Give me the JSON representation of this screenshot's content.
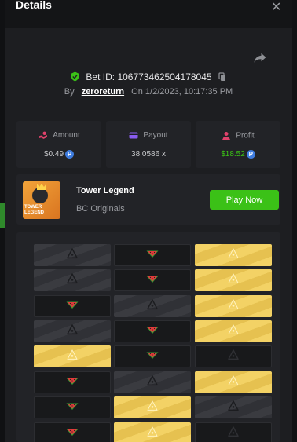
{
  "header": {
    "title": "Details",
    "close_glyph": "✕"
  },
  "bet": {
    "id_label": "Bet ID:",
    "id": "106773462504178045",
    "by_label": "By",
    "user": "zeroreturn",
    "on_label": "On",
    "datetime": "1/2/2023, 10:17:35 PM"
  },
  "stats": {
    "amount": {
      "label": "Amount",
      "value": "$0.49",
      "icon": "money-hand-icon",
      "color": "#e0426b"
    },
    "payout": {
      "label": "Payout",
      "value": "38.0586 x",
      "icon": "wallet-icon",
      "color": "#8a5cf0"
    },
    "profit": {
      "label": "Profit",
      "value": "$18.52",
      "icon": "profit-icon",
      "color": "#e0426b",
      "value_color": "#3bc117"
    }
  },
  "game": {
    "thumb_title": "TOWER LEGEND",
    "name": "Tower Legend",
    "provider": "BC Originals",
    "play_label": "Play Now"
  },
  "board": {
    "rows": [
      [
        "gray-skull",
        "dark-melon",
        "gold-skull"
      ],
      [
        "gray-skull",
        "dark-melon",
        "gold-skull"
      ],
      [
        "dark-melon",
        "gray-skull",
        "gold-skull"
      ],
      [
        "gray-skull",
        "dark-melon",
        "gold-skull"
      ],
      [
        "gold-skull",
        "dark-melon",
        "dark-skull"
      ],
      [
        "dark-melon",
        "gray-skull",
        "gold-skull"
      ],
      [
        "dark-melon",
        "gold-skull",
        "gray-skull"
      ],
      [
        "dark-melon",
        "gold-skull",
        "dark-skull"
      ]
    ]
  },
  "colors": {
    "accent_green": "#3bc117",
    "gold": "#f3d265",
    "coin": "#3f7de0"
  }
}
